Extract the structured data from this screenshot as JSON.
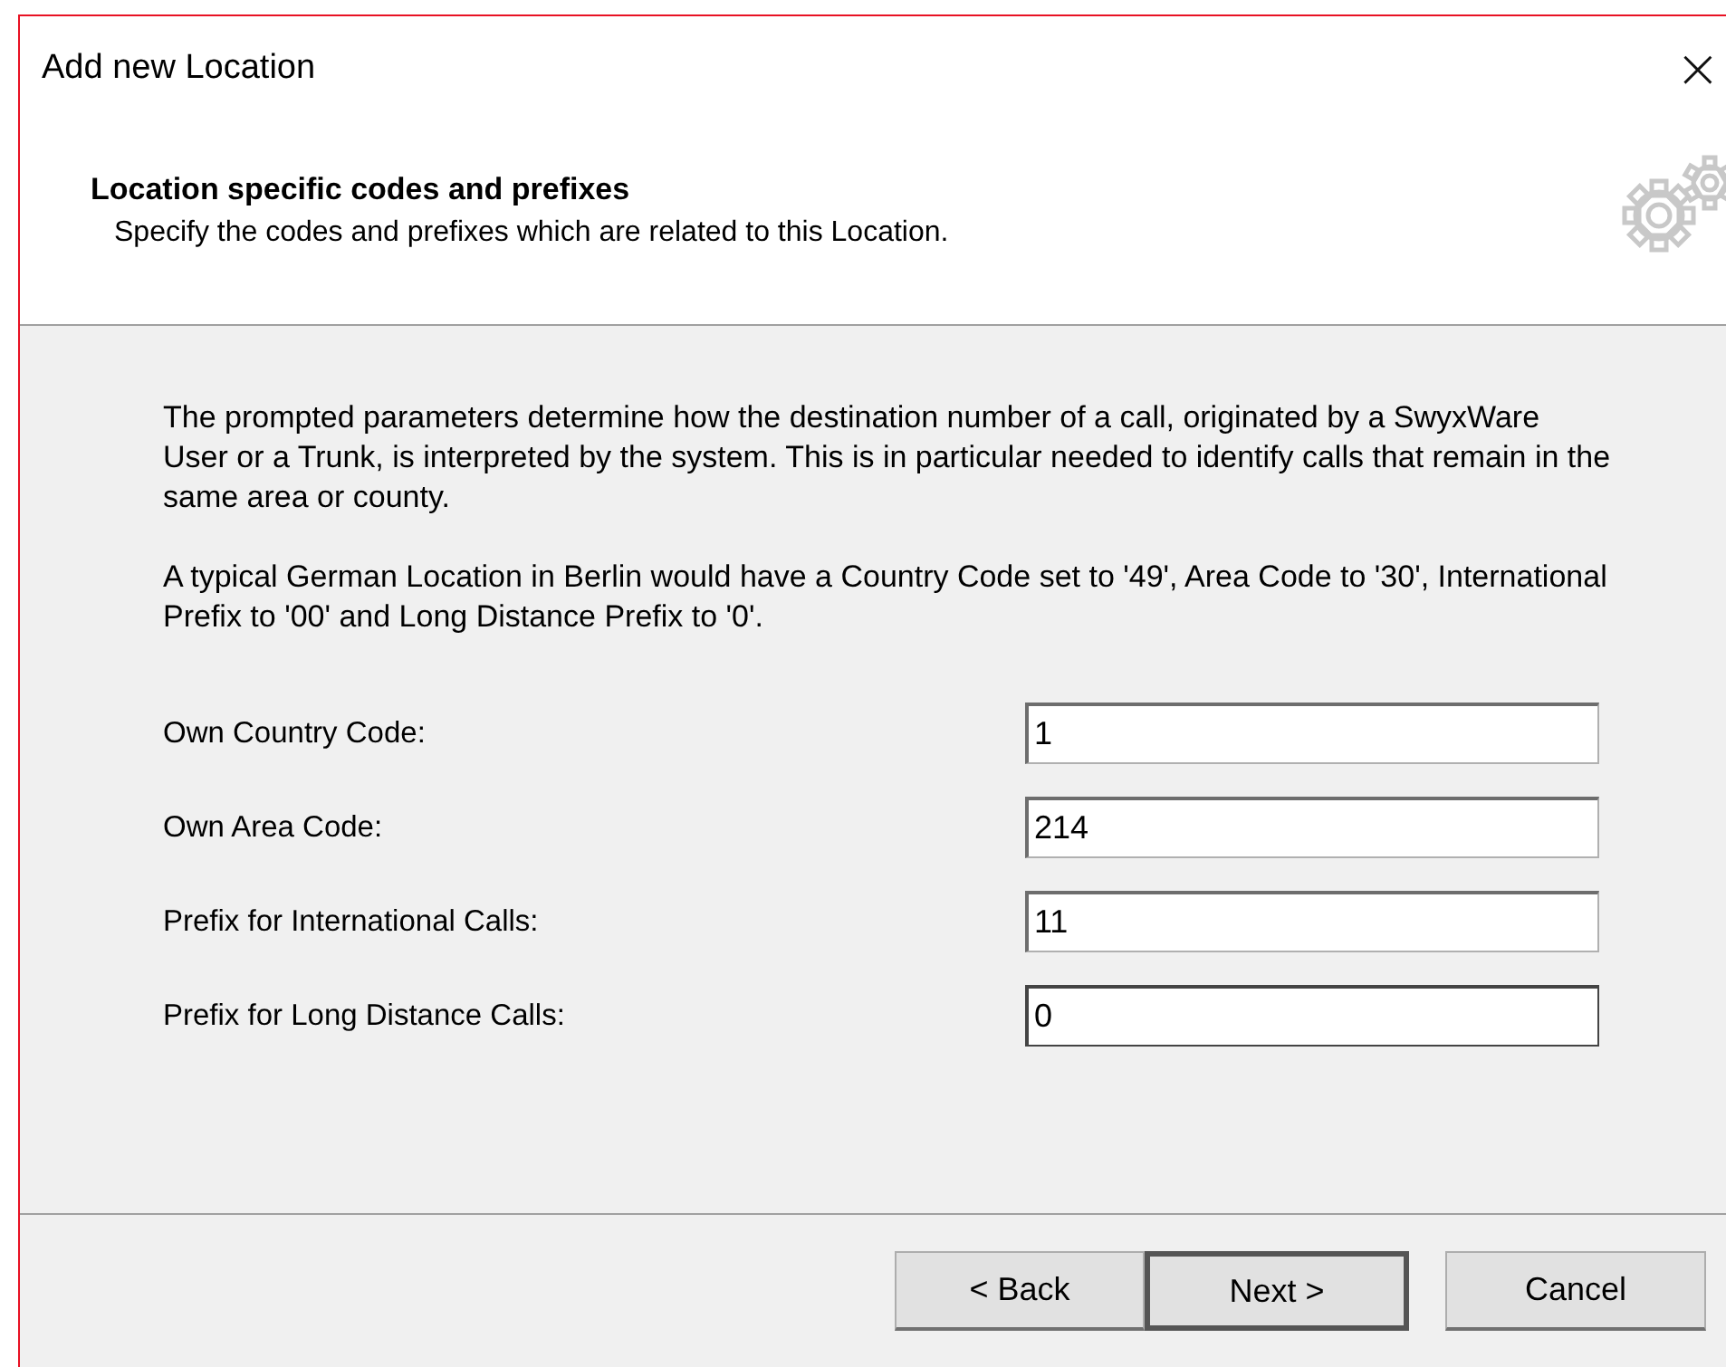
{
  "window": {
    "title": "Add new Location",
    "close": "×"
  },
  "header": {
    "title": "Location specific codes and prefixes",
    "subtitle": "Specify the codes and prefixes which are related to this Location."
  },
  "paragraphs": [
    "The prompted parameters determine how the destination number of a call, originated by a SwyxWare User or a Trunk, is interpreted by the system. This is in particular needed to identify calls that remain in the same area or county.",
    "A typical German Location in Berlin would have a Country Code set to '49', Area Code to '30', International Prefix to '00' and Long Distance Prefix to '0'."
  ],
  "fields": [
    {
      "label": "Own Country Code:",
      "value": "1",
      "focused": false
    },
    {
      "label": "Own Area Code:",
      "value": "214",
      "focused": false
    },
    {
      "label": "Prefix for International Calls:",
      "value": "11",
      "focused": false
    },
    {
      "label": "Prefix for Long Distance Calls:",
      "value": "0",
      "focused": true
    }
  ],
  "buttons": [
    {
      "label": "< Back",
      "default": false
    },
    {
      "label": "Next >",
      "default": true
    },
    {
      "label": "Cancel",
      "default": false
    }
  ]
}
